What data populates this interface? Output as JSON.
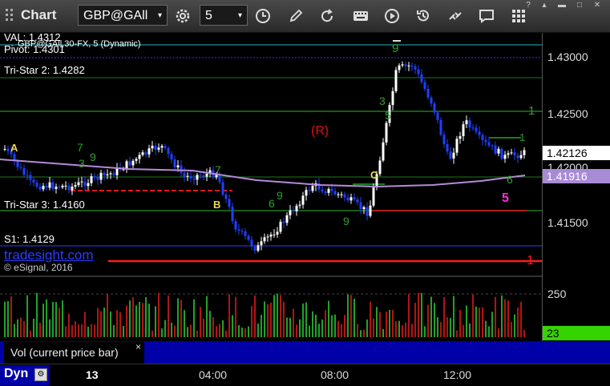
{
  "toolbar": {
    "title": "Chart",
    "symbol": "GBP@GAll",
    "interval": "5"
  },
  "levels": {
    "val": "VAL: 1.4312",
    "pivot": "Pivot: 1.4301",
    "study": "GBP@GAll,30-FX, 5 (Dynamic)",
    "tristar2": "Tri-Star 2: 1.4282",
    "tristar3": "Tri-Star 3: 1.4160",
    "s1": "S1: 1.4129",
    "brand": "tradesight.com",
    "copyright": "© eSignal, 2016"
  },
  "annotations": {
    "a": "A",
    "b": "B",
    "c": "C",
    "r": "(R)",
    "nine_top": "9",
    "n1": "1",
    "n2": "1",
    "n3": "1",
    "pink": "5"
  },
  "axis": {
    "ticks": [
      "1.43000",
      "1.42500",
      "1.42000",
      "1.41500"
    ],
    "last_price": "1.42126",
    "ma_value": "1.41916",
    "vol_tick": "250",
    "vol_value": "23"
  },
  "volume_pane": {
    "label": "Vol (current price bar)",
    "close": "×"
  },
  "time_axis": {
    "dyn": "Dyn",
    "labels": [
      "13",
      "04:00",
      "08:00",
      "12:00"
    ]
  },
  "colors": {
    "up": "#ffffff",
    "down": "#1f3fff",
    "ma": "#b58ad9",
    "volume_up": "#1fa32a",
    "volume_down": "#b21414",
    "vol_tag": "#35d400"
  }
}
